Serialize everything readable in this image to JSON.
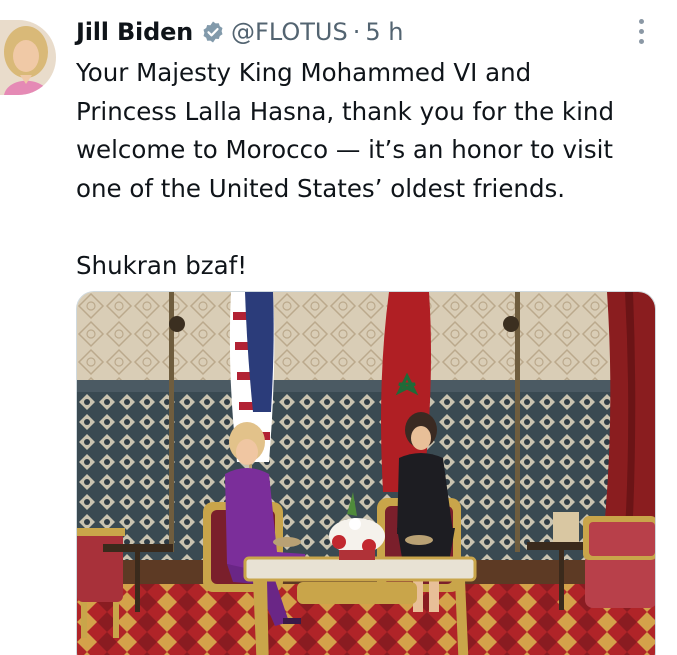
{
  "tweet": {
    "author": {
      "display_name": "Jill Biden",
      "handle": "@FLOTUS",
      "verified_icon": "verified-badge-icon",
      "verified_color": "#829aab"
    },
    "separator": "·",
    "timestamp": "5 h",
    "more_icon": "vertical-ellipsis-icon",
    "text_lines": [
      "Your Majesty King Mohammed VI and",
      "Princess Lalla Hasna, thank you for the kind",
      "welcome to Morocco — it’s an honor to visit",
      "one of the United States’ oldest friends."
    ],
    "closing_line": "Shukran bzaf!",
    "media": {
      "type": "photo"
    }
  }
}
